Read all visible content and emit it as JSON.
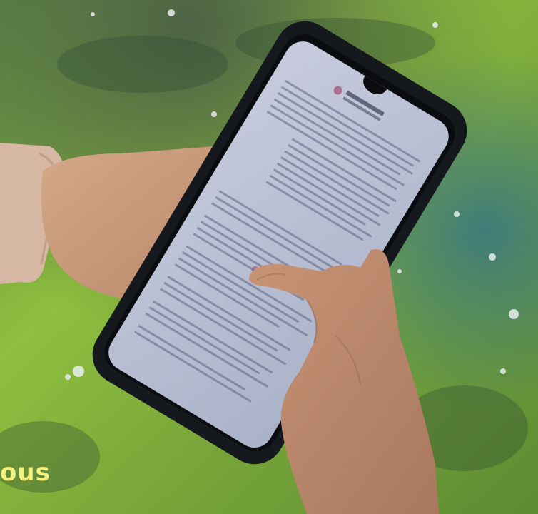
{
  "caption": {
    "text": "ous"
  },
  "colors": {
    "table_green": "#7fae3a",
    "table_dark": "#3e5a2a",
    "table_blue": "#3f6f92",
    "phone_body": "#15181d",
    "screen": "#c9cedd",
    "skin": "#c79a7c",
    "sleeve": "#d9b9a4",
    "caption": "#f4f080"
  }
}
